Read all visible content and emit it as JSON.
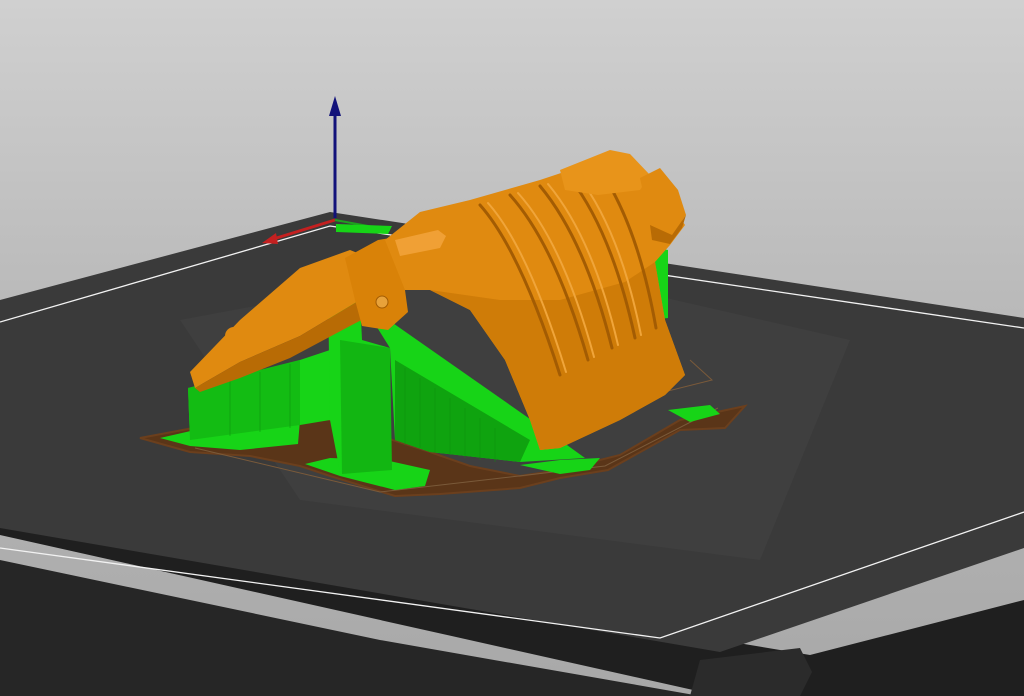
{
  "viewport": {
    "kind": "3d-slicer-preview",
    "background_top": "#d0d0d0",
    "background_bottom": "#a8a8a8"
  },
  "bed": {
    "surface_color": "#3a3a3a",
    "edge_color": "#1f1f1f",
    "outline_color": "#f2f2f2",
    "logo_glyph": "ʖ"
  },
  "axes": {
    "z_color": "#12127a",
    "x_color": "#c42020",
    "y_color": "#1fa01f"
  },
  "model": {
    "colors": {
      "perimeter": "#e08a10",
      "perimeter_shade": "#b86b05",
      "support": "#17d417",
      "support_shade": "#0f9a0f",
      "skirt": "#6b3f1d",
      "travel": "#7a5a3a"
    },
    "description_visible": false
  }
}
